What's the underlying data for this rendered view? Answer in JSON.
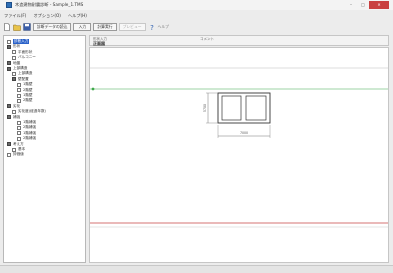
{
  "window": {
    "title": "木造建物耐震診断 - Sample_1.TMS",
    "minimize_glyph": "–",
    "maximize_glyph": "□",
    "close_glyph": "✕"
  },
  "menu": [
    "ファイル(F)",
    "オプション(O)",
    "ヘルプ(H)"
  ],
  "toolbar": {
    "icons": [
      "new-file-icon",
      "open-folder-icon",
      "save-icon"
    ],
    "open_data_label": "診断データの読込",
    "input_label": "入力",
    "judge_label": "計算実行",
    "print_label": "プレビュー",
    "help_icon": "help-icon",
    "help_text": "ヘルプ"
  },
  "sidebar": {
    "items": [
      {
        "label": "診断入力",
        "level": 0,
        "selected": true,
        "folder": false
      },
      {
        "label": "形状",
        "level": 0,
        "selected": false,
        "folder": true
      },
      {
        "label": "平面形状",
        "level": 1,
        "selected": false,
        "folder": false
      },
      {
        "label": "バルコニー",
        "level": 1,
        "selected": false,
        "folder": false
      },
      {
        "label": "地盤",
        "level": 0,
        "selected": false,
        "folder": true
      },
      {
        "label": "上部構造",
        "level": 0,
        "selected": false,
        "folder": true
      },
      {
        "label": "上部構造",
        "level": 1,
        "selected": false,
        "folder": false
      },
      {
        "label": "壁配置",
        "level": 1,
        "selected": false,
        "folder": true
      },
      {
        "label": "1階壁",
        "level": 2,
        "selected": false,
        "folder": false
      },
      {
        "label": "2階壁",
        "level": 2,
        "selected": false,
        "folder": false
      },
      {
        "label": "1階壁",
        "level": 2,
        "selected": false,
        "folder": false
      },
      {
        "label": "2階壁",
        "level": 2,
        "selected": false,
        "folder": false
      },
      {
        "label": "劣化",
        "level": 0,
        "selected": false,
        "folder": true
      },
      {
        "label": "劣化度(経過年数)",
        "level": 1,
        "selected": false,
        "folder": false
      },
      {
        "label": "補強",
        "level": 0,
        "selected": false,
        "folder": true
      },
      {
        "label": "1階補強",
        "level": 2,
        "selected": false,
        "folder": false
      },
      {
        "label": "2階補強",
        "level": 2,
        "selected": false,
        "folder": false
      },
      {
        "label": "1階補強",
        "level": 2,
        "selected": false,
        "folder": false
      },
      {
        "label": "2階補強",
        "level": 2,
        "selected": false,
        "folder": false
      },
      {
        "label": "考え方",
        "level": 0,
        "selected": false,
        "folder": true
      },
      {
        "label": "基本",
        "level": 1,
        "selected": false,
        "folder": false
      },
      {
        "label": "評価値",
        "level": 0,
        "selected": false,
        "folder": false
      }
    ]
  },
  "pane": {
    "left_caption": "形状入力",
    "right_caption": "コメント",
    "title": "正面図"
  },
  "drawing": {
    "width_dim": "7000",
    "height_dim": "5700"
  }
}
